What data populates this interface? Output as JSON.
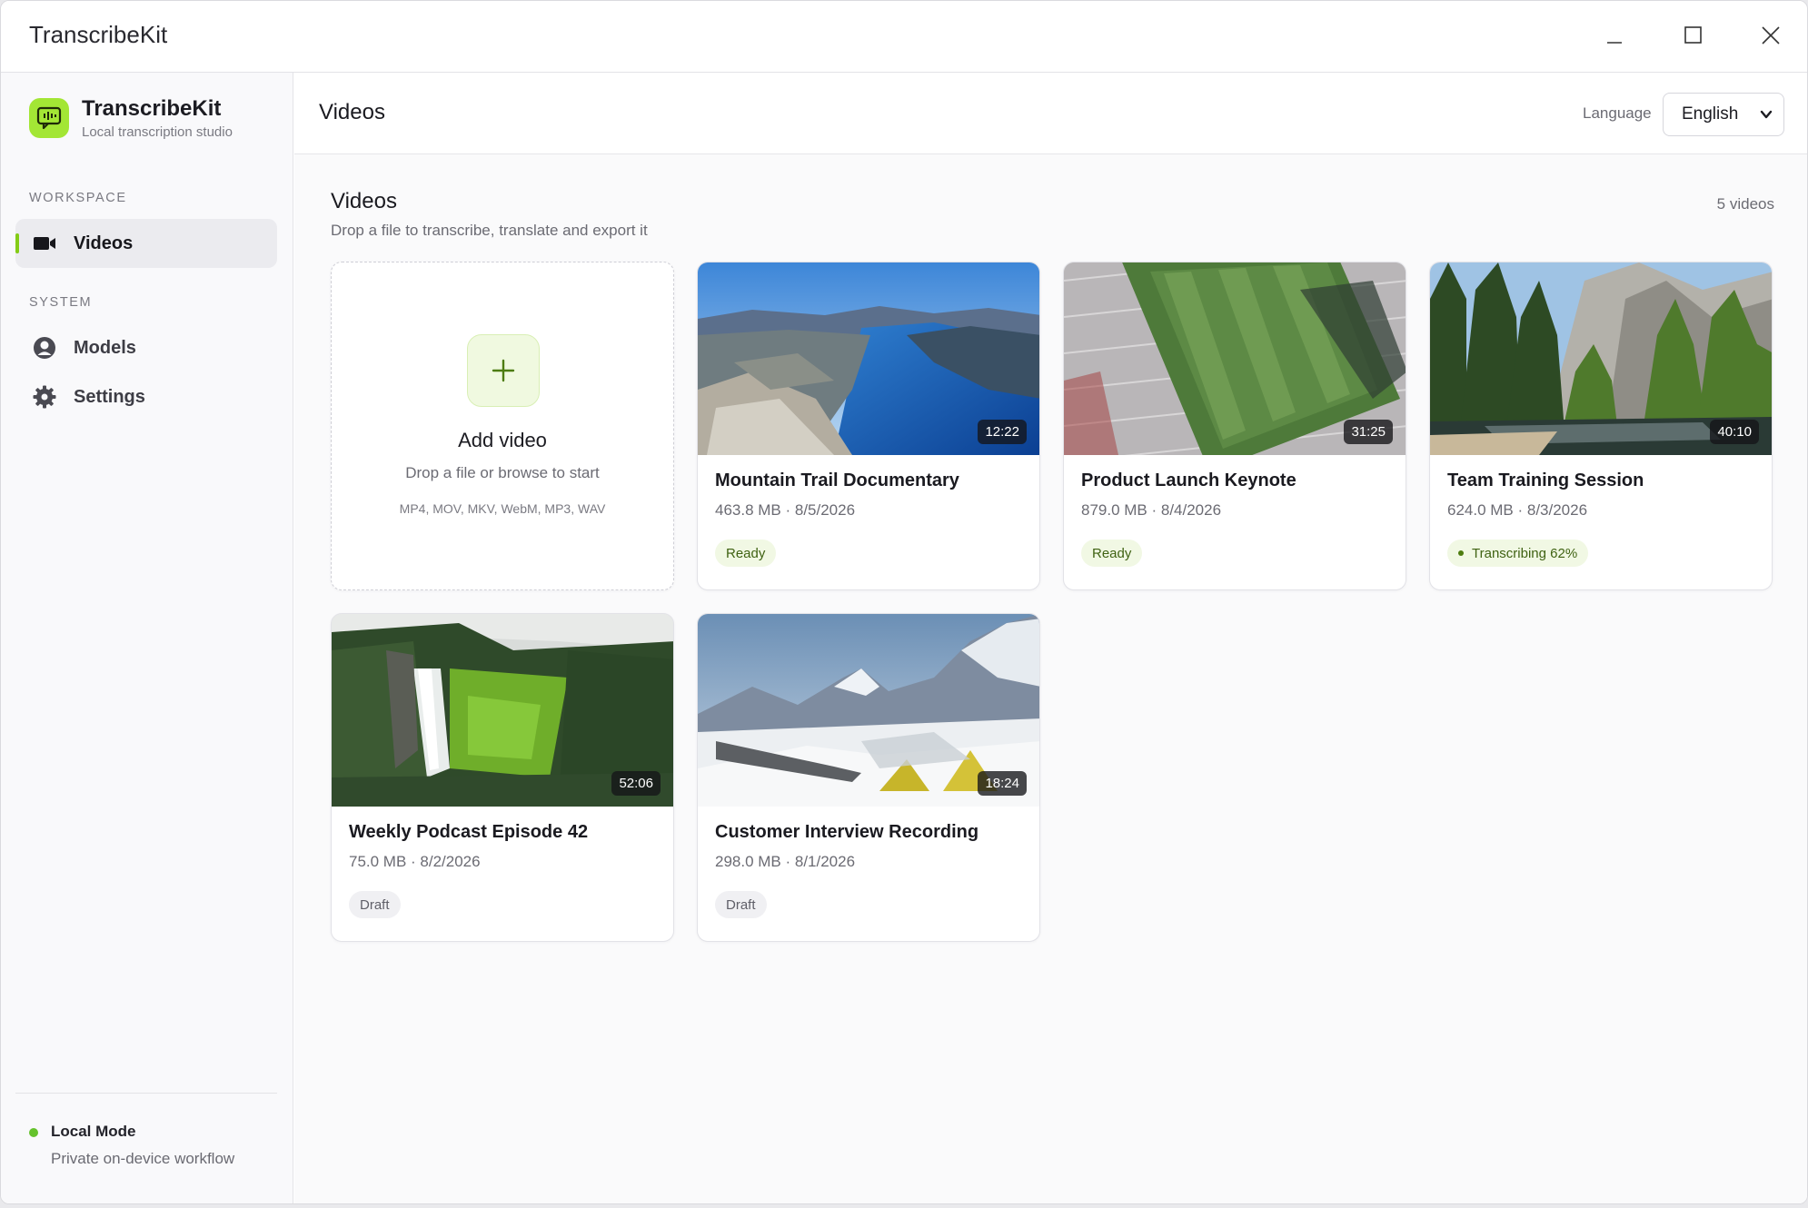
{
  "window": {
    "title": "TranscribeKit"
  },
  "sidebar": {
    "brand_name": "TranscribeKit",
    "brand_subtitle": "Local transcription studio",
    "workspace_label": "WORKSPACE",
    "system_label": "SYSTEM",
    "items": [
      {
        "label": "Videos",
        "icon": "video-camera-icon",
        "active": true
      },
      {
        "label": "Models",
        "icon": "user-circle-icon",
        "active": false
      },
      {
        "label": "Settings",
        "icon": "gear-icon",
        "active": false
      }
    ],
    "footer": {
      "title": "Local Mode",
      "subtitle": "Private on-device workflow"
    }
  },
  "header": {
    "title": "Videos",
    "language_label": "Language",
    "language_value": "English"
  },
  "content": {
    "title": "Videos",
    "subtitle": "Drop a file to transcribe, translate and export it",
    "count": "5 videos",
    "add_card": {
      "title": "Add video",
      "subtitle": "Drop a file or browse to start",
      "formats": "MP4, MOV, MKV, WebM, MP3, WAV"
    },
    "videos": [
      {
        "title": "Mountain Trail Documentary",
        "meta": "463.8 MB · 8/5/2026",
        "duration": "12:22",
        "status": "Ready"
      },
      {
        "title": "Product Launch Keynote",
        "meta": "879.0 MB · 8/4/2026",
        "duration": "31:25",
        "status": "Ready"
      },
      {
        "title": "Team Training Session",
        "meta": "624.0 MB · 8/3/2026",
        "duration": "40:10",
        "status": "Transcribing 62%"
      },
      {
        "title": "Weekly Podcast Episode 42",
        "meta": "75.0 MB · 8/2/2026",
        "duration": "52:06",
        "status": "Draft"
      },
      {
        "title": "Customer Interview Recording",
        "meta": "298.0 MB · 8/1/2026",
        "duration": "18:24",
        "status": "Draft"
      }
    ]
  },
  "colors": {
    "accent": "#84cc16",
    "logo_bg": "#a3e635",
    "status_dot": "#65c22c"
  }
}
